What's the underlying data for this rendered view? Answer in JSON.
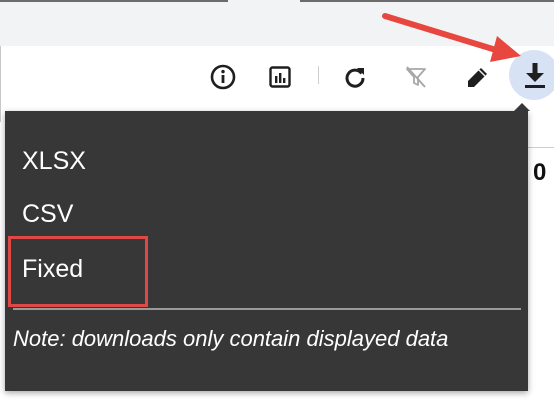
{
  "toolbar": {
    "icons": [
      "info-icon",
      "chart-icon",
      "refresh-icon",
      "clear-filter-icon",
      "edit-icon",
      "download-icon"
    ]
  },
  "download_menu": {
    "items": [
      {
        "label": "XLSX"
      },
      {
        "label": "CSV"
      },
      {
        "label": "Fixed"
      }
    ],
    "note": "Note: downloads only contain displayed data"
  },
  "background": {
    "partial_value": "0"
  },
  "annotations": {
    "arrow_color": "#e8473f",
    "highlight_color": "#e04848",
    "highlight_target": "Fixed"
  },
  "colors": {
    "menu_bg": "#373737",
    "menu_text": "#ffffff",
    "download_active_bg": "#d7e3f4"
  }
}
